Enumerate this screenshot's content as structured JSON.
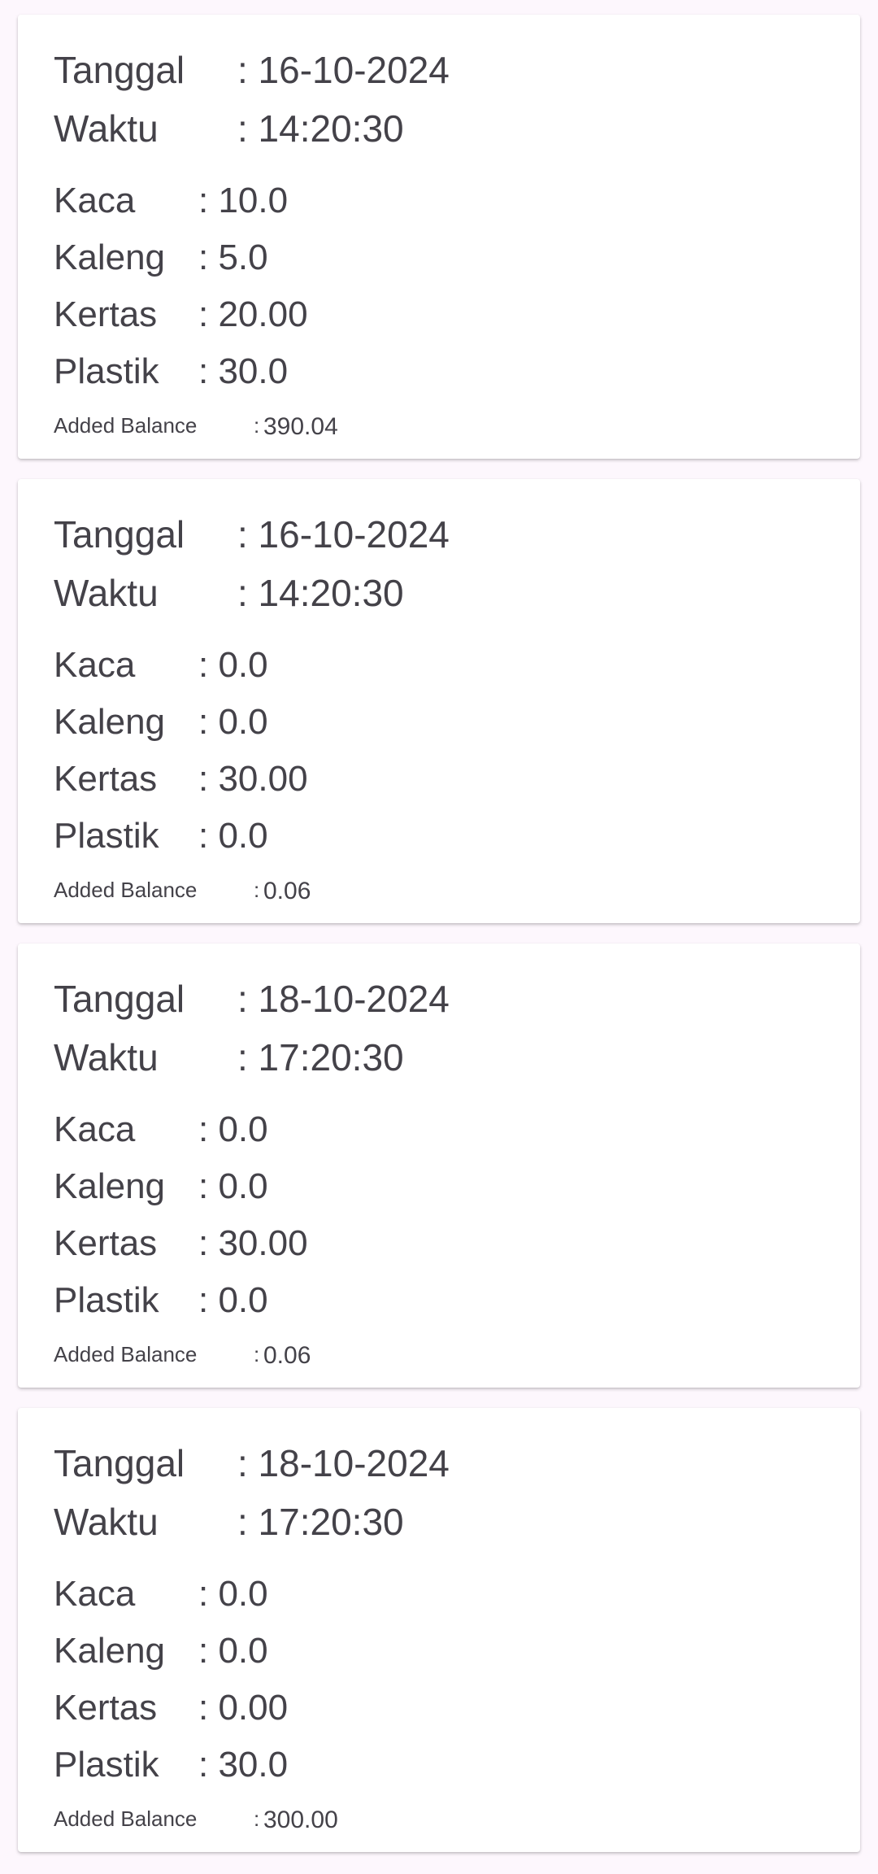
{
  "records": [
    {
      "tanggal_label": "Tanggal",
      "tanggal_value": ": 16-10-2024",
      "waktu_label": "Waktu",
      "waktu_value": ": 14:20:30",
      "kaca_label": "Kaca",
      "kaca_value": ": 10.0",
      "kaleng_label": "Kaleng",
      "kaleng_value": ": 5.0",
      "kertas_label": "Kertas",
      "kertas_value": ": 20.00",
      "plastik_label": "Plastik",
      "plastik_value": ": 30.0",
      "balance_label": "Added Balance",
      "balance_colon": ":",
      "balance_value": "390.04"
    },
    {
      "tanggal_label": "Tanggal",
      "tanggal_value": ": 16-10-2024",
      "waktu_label": "Waktu",
      "waktu_value": ": 14:20:30",
      "kaca_label": "Kaca",
      "kaca_value": ": 0.0",
      "kaleng_label": "Kaleng",
      "kaleng_value": ": 0.0",
      "kertas_label": "Kertas",
      "kertas_value": ": 30.00",
      "plastik_label": "Plastik",
      "plastik_value": ": 0.0",
      "balance_label": "Added Balance",
      "balance_colon": ":",
      "balance_value": "0.06"
    },
    {
      "tanggal_label": "Tanggal",
      "tanggal_value": ": 18-10-2024",
      "waktu_label": "Waktu",
      "waktu_value": ": 17:20:30",
      "kaca_label": "Kaca",
      "kaca_value": ": 0.0",
      "kaleng_label": "Kaleng",
      "kaleng_value": ": 0.0",
      "kertas_label": "Kertas",
      "kertas_value": ": 30.00",
      "plastik_label": "Plastik",
      "plastik_value": ": 0.0",
      "balance_label": "Added Balance",
      "balance_colon": ":",
      "balance_value": "0.06"
    },
    {
      "tanggal_label": "Tanggal",
      "tanggal_value": ": 18-10-2024",
      "waktu_label": "Waktu",
      "waktu_value": ": 17:20:30",
      "kaca_label": "Kaca",
      "kaca_value": ": 0.0",
      "kaleng_label": "Kaleng",
      "kaleng_value": ": 0.0",
      "kertas_label": "Kertas",
      "kertas_value": ": 0.00",
      "plastik_label": "Plastik",
      "plastik_value": ": 30.0",
      "balance_label": "Added Balance",
      "balance_colon": ":",
      "balance_value": "300.00"
    }
  ]
}
